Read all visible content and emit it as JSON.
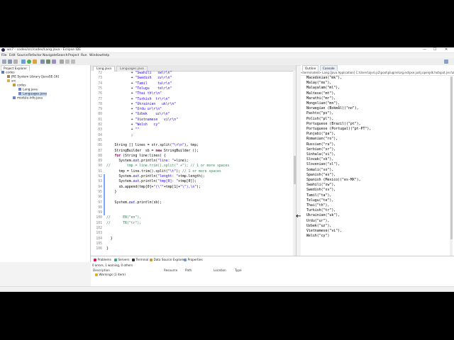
{
  "window": {
    "title": "ws7 - codes/src/codes/Lang.java - Eclipse IDE",
    "min": "—",
    "max": "☐",
    "close": "✕"
  },
  "menu": [
    "File",
    "Edit",
    "Source",
    "Refactor",
    "Navigate",
    "Search",
    "Project",
    "Run",
    "Window",
    "Help"
  ],
  "explorer": {
    "tab_label": "Project Explorer",
    "items": [
      {
        "label": "codes",
        "indent": 0,
        "icon": "project-icon"
      },
      {
        "label": "JRE System Library [JavaSE-16]",
        "indent": 1,
        "icon": "library-icon"
      },
      {
        "label": "src",
        "indent": 1,
        "icon": "folder-icon"
      },
      {
        "label": "codes",
        "indent": 2,
        "icon": "package-icon"
      },
      {
        "label": "Lang.java",
        "indent": 3,
        "icon": "java-file-icon"
      },
      {
        "label": "Languages.java",
        "indent": 3,
        "icon": "java-file-icon"
      },
      {
        "label": "module-info.java",
        "indent": 2,
        "icon": "java-file-icon"
      }
    ]
  },
  "editor": {
    "tabs": [
      {
        "label": "Lang.java",
        "active": true
      },
      {
        "label": "Languages.java",
        "active": false
      }
    ],
    "line_numbers": [
      "72",
      "73",
      "74",
      "75",
      "76",
      "77",
      "78",
      "79",
      "80",
      "81",
      "82",
      "83",
      "84",
      "85",
      "86",
      "87",
      "88",
      "89",
      "90",
      "91",
      "92",
      "93",
      "94",
      "95",
      "96",
      "97",
      "98",
      "99",
      "100",
      "101",
      "102",
      "103",
      "104",
      "105",
      "106"
    ]
  },
  "console": {
    "outline_tab": "Outline",
    "console_tab": "Console",
    "path": "<terminated> Lang [Java Application] C:\\Users\\ajvs\\.p2\\pool\\plugins\\org.eclipse.justj.openjdk.hotspot.jre.full.win32.x86_64",
    "lines": [
      "Macedonian(\"mk\"),",
      "Malay(\"ms\"),",
      "Malayalam(\"ml\"),",
      "Maltese(\"mt\"),",
      "Marathi(\"mr\"),",
      "Mongolian(\"mn\"),",
      "Norwegian (Bokmål)(\"no\"),",
      "Pashto(\"ps\"),",
      "Polish(\"pl\"),",
      "Portuguese (Brazil)(\"pt\"),",
      "Portuguese (Portugal)(\"pt-PT\"),",
      "Punjabi(\"pa\"),",
      "Romanian(\"ro\"),",
      "Russian(\"ru\"),",
      "Serbian(\"sr\"),",
      "Sinhala(\"si\"),",
      "Slovak(\"sk\"),",
      "Slovenian(\"sl\"),",
      "Somali(\"so\"),",
      "Spanish(\"es\"),",
      "Spanish (Mexico)(\"es-MX\"),",
      "Swahili(\"sw\"),",
      "Swedish(\"sv\"),",
      "Tamil(\"ta\"),",
      "Telugu(\"te\"),",
      "Thai(\"th\"),",
      "Turkish(\"tr\"),",
      "Ukrainian(\"uk\"),",
      "Urdu(\"ur\"),",
      "Uzbek(\"uz\"),",
      "Vietnamese(\"vi\"),",
      "Welsh(\"cy\")"
    ]
  },
  "bottom": {
    "tabs": [
      "Problems",
      "Servers",
      "Terminal",
      "Data Source Explorer",
      "Properties"
    ],
    "summary": "0 errors, 1 warning, 0 others",
    "columns": [
      "Description",
      "Resource",
      "Path",
      "Location",
      "Type"
    ],
    "rows": [
      "Warnings (1 item)"
    ]
  }
}
